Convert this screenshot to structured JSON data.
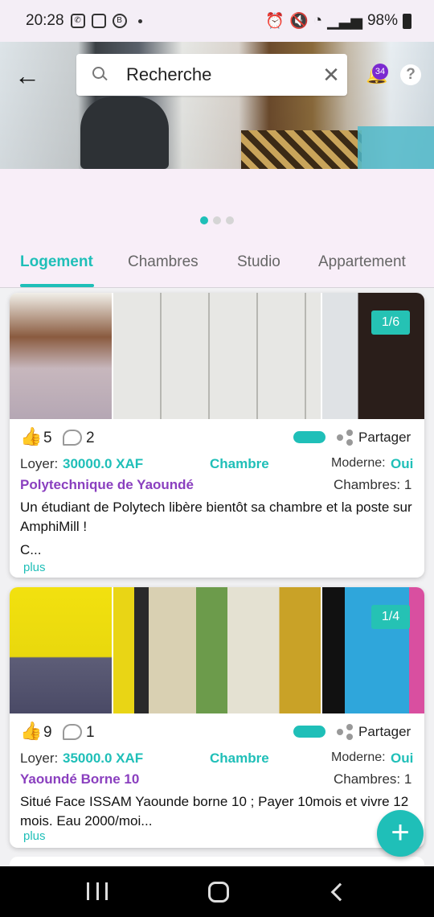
{
  "status": {
    "time": "20:28",
    "battery": "98%"
  },
  "search": {
    "value": "Recherche"
  },
  "notifications": {
    "count": "34"
  },
  "tabs": [
    {
      "label": "Logement"
    },
    {
      "label": "Chambres"
    },
    {
      "label": "Studio"
    },
    {
      "label": "Appartement"
    }
  ],
  "listings": [
    {
      "counter": "1/6",
      "likes": "5",
      "comments": "2",
      "share_label": "Partager",
      "rent_label": "Loyer:",
      "price": "30000.0 XAF",
      "type": "Chambre",
      "modern_label": "Moderne:",
      "modern_value": "Oui",
      "location": "Polytechnique de Yaoundé",
      "rooms": "Chambres: 1",
      "description": "Un étudiant de Polytech libère bientôt sa chambre et la poste sur AmphiMill !",
      "description_more": "C...",
      "more_label": "plus"
    },
    {
      "counter": "1/4",
      "likes": "9",
      "comments": "1",
      "share_label": "Partager",
      "rent_label": "Loyer:",
      "price": "35000.0 XAF",
      "type": "Chambre",
      "modern_label": "Moderne:",
      "modern_value": "Oui",
      "location": "Yaoundé Borne 10",
      "rooms": "Chambres: 1",
      "description": "Situé Face ISSAM Yaounde borne 10 ; Payer 10mois et vivre 12 mois.  Eau 2000/moi...",
      "more_label": "plus"
    }
  ],
  "fab": {
    "icon": "plus-icon",
    "label": "+"
  },
  "colors": {
    "accent": "#1fbfb8",
    "purple": "#8a3fbf"
  }
}
